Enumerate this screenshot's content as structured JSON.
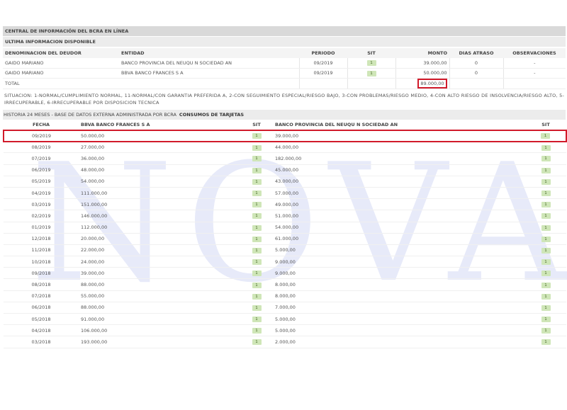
{
  "header": {
    "title": "CENTRAL DE INFORMACIÓN DEL BCRA EN LÍNEA",
    "subtitle": "ULTIMA INFORMACION DISPONIBLE"
  },
  "debt_table": {
    "columns": {
      "deudor": "DENOMINACION DEL DEUDOR",
      "entidad": "ENTIDAD",
      "periodo": "PERIODO",
      "sit": "SIT",
      "monto": "MONTO",
      "dias": "DIAS ATRASO",
      "obs": "OBSERVACIONES"
    },
    "rows": [
      {
        "deudor": "GAIDO MARIANO",
        "entidad": "BANCO PROVINCIA DEL NEUQU N SOCIEDAD AN",
        "periodo": "09/2019",
        "sit": "1",
        "monto": "39.000,00",
        "dias": "0",
        "obs": "-"
      },
      {
        "deudor": "GAIDO MARIANO",
        "entidad": "BBVA BANCO FRANCES S A",
        "periodo": "09/2019",
        "sit": "1",
        "monto": "50.000,00",
        "dias": "0",
        "obs": "-"
      }
    ],
    "total_label": "TOTAL",
    "total_value": "89.000,00"
  },
  "legend": "SITUACION: 1-NORMAL/CUMPLIMIENTO NORMAL, 11-NORMAL/CON GARANTIA PREFERIDA A, 2-CON SEGUIMIENTO ESPECIAL/RIESGO BAJO, 3-CON PROBLEMAS/RIESGO MEDIO, 4-CON ALTO RIESGO DE INSOLVENCIA/RIESGO ALTO, 5-IRRECUPERABLE, 6-IRRECUPERABLE POR DISPOSICION TECNICA",
  "history": {
    "title": "HISTORIA 24 MESES - BASE DE DATOS EXTERNA ADMINISTRADA POR BCRA",
    "subtitle": "CONSUMOS DE TARJETAS",
    "columns": {
      "fecha": "FECHA",
      "bank1": "BBVA BANCO FRANCES S A",
      "sit1": "SIT",
      "bank2": "BANCO PROVINCIA DEL NEUQU N SOCIEDAD AN",
      "sit2": "SIT"
    },
    "rows": [
      {
        "fecha": "09/2019",
        "b1": "50.000,00",
        "s1": "1",
        "b2": "39.000,00",
        "s2": "1"
      },
      {
        "fecha": "08/2019",
        "b1": "27.000,00",
        "s1": "1",
        "b2": "44.000,00",
        "s2": "1"
      },
      {
        "fecha": "07/2019",
        "b1": "36.000,00",
        "s1": "1",
        "b2": "182.000,00",
        "s2": "1"
      },
      {
        "fecha": "06/2019",
        "b1": "48.000,00",
        "s1": "1",
        "b2": "45.000,00",
        "s2": "1"
      },
      {
        "fecha": "05/2019",
        "b1": "54.000,00",
        "s1": "1",
        "b2": "43.000,00",
        "s2": "1"
      },
      {
        "fecha": "04/2019",
        "b1": "111.000,00",
        "s1": "1",
        "b2": "57.000,00",
        "s2": "1"
      },
      {
        "fecha": "03/2019",
        "b1": "151.000,00",
        "s1": "1",
        "b2": "49.000,00",
        "s2": "1"
      },
      {
        "fecha": "02/2019",
        "b1": "146.000,00",
        "s1": "1",
        "b2": "51.000,00",
        "s2": "1"
      },
      {
        "fecha": "01/2019",
        "b1": "112.000,00",
        "s1": "1",
        "b2": "54.000,00",
        "s2": "1"
      },
      {
        "fecha": "12/2018",
        "b1": "20.000,00",
        "s1": "1",
        "b2": "61.000,00",
        "s2": "1"
      },
      {
        "fecha": "11/2018",
        "b1": "22.000,00",
        "s1": "1",
        "b2": "5.000,00",
        "s2": "1"
      },
      {
        "fecha": "10/2018",
        "b1": "24.000,00",
        "s1": "1",
        "b2": "9.000,00",
        "s2": "1"
      },
      {
        "fecha": "09/2018",
        "b1": "39.000,00",
        "s1": "1",
        "b2": "9.000,00",
        "s2": "1"
      },
      {
        "fecha": "08/2018",
        "b1": "88.000,00",
        "s1": "1",
        "b2": "8.000,00",
        "s2": "1"
      },
      {
        "fecha": "07/2018",
        "b1": "55.000,00",
        "s1": "1",
        "b2": "8.000,00",
        "s2": "1"
      },
      {
        "fecha": "06/2018",
        "b1": "88.000,00",
        "s1": "1",
        "b2": "7.000,00",
        "s2": "1"
      },
      {
        "fecha": "05/2018",
        "b1": "91.000,00",
        "s1": "1",
        "b2": "5.000,00",
        "s2": "1"
      },
      {
        "fecha": "04/2018",
        "b1": "106.000,00",
        "s1": "1",
        "b2": "5.000,00",
        "s2": "1"
      },
      {
        "fecha": "03/2018",
        "b1": "193.000,00",
        "s1": "1",
        "b2": "2.000,00",
        "s2": "1"
      }
    ]
  },
  "watermark": "NOVA",
  "colors": {
    "highlight": "#d11a2a",
    "badge_bg": "#cfe6b8",
    "watermark": "#dfe3f7"
  }
}
